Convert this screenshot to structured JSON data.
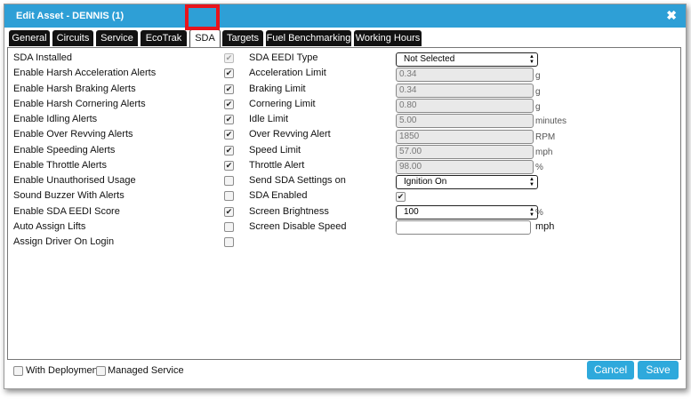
{
  "dialog": {
    "title": "Edit Asset - DENNIS (1)",
    "close_icon": "close-icon",
    "accent": "#2e9fd6"
  },
  "tabs": [
    "General",
    "Circuits",
    "Service",
    "EcoTrak",
    "SDA",
    "Targets",
    "Fuel Benchmarking",
    "Working Hours"
  ],
  "active_tab": "SDA",
  "left_settings": [
    {
      "label": "SDA Installed",
      "checked": true,
      "disabled": true
    },
    {
      "label": "Enable Harsh Acceleration Alerts",
      "checked": true
    },
    {
      "label": "Enable Harsh Braking Alerts",
      "checked": true
    },
    {
      "label": "Enable Harsh Cornering Alerts",
      "checked": true
    },
    {
      "label": "Enable Idling Alerts",
      "checked": true
    },
    {
      "label": "Enable Over Revving Alerts",
      "checked": true
    },
    {
      "label": "Enable Speeding Alerts",
      "checked": true
    },
    {
      "label": "Enable Throttle Alerts",
      "checked": true
    },
    {
      "label": "Enable Unauthorised Usage",
      "checked": false
    },
    {
      "label": "Sound Buzzer With Alerts",
      "checked": false
    },
    {
      "label": "Enable SDA EEDI Score",
      "checked": true
    },
    {
      "label": "Auto Assign Lifts",
      "checked": false
    },
    {
      "label": "Assign Driver On Login",
      "checked": false
    }
  ],
  "right_settings": {
    "eedi_type": {
      "label": "SDA EEDI Type",
      "value": "Not Selected"
    },
    "acceleration_limit": {
      "label": "Acceleration Limit",
      "value": "0.34",
      "unit": "g"
    },
    "braking_limit": {
      "label": "Braking Limit",
      "value": "0.34",
      "unit": "g"
    },
    "cornering_limit": {
      "label": "Cornering Limit",
      "value": "0.80",
      "unit": "g"
    },
    "idle_limit": {
      "label": "Idle Limit",
      "value": "5.00",
      "unit": "minutes"
    },
    "over_revving_alert": {
      "label": "Over Revving Alert",
      "value": "1850",
      "unit": "RPM"
    },
    "speed_limit": {
      "label": "Speed Limit",
      "value": "57.00",
      "unit": "mph"
    },
    "throttle_alert": {
      "label": "Throttle Alert",
      "value": "98.00",
      "unit": "%"
    },
    "send_settings_on": {
      "label": "Send SDA Settings on",
      "value": "Ignition On"
    },
    "sda_enabled": {
      "label": "SDA Enabled",
      "checked": true
    },
    "screen_brightness": {
      "label": "Screen Brightness",
      "value": "100",
      "unit": "%"
    },
    "screen_disable_speed": {
      "label": "Screen Disable Speed",
      "value": "",
      "unit": "mph"
    }
  },
  "footer": {
    "with_deployment": {
      "label": "With Deployment",
      "checked": false
    },
    "managed_service": {
      "label": "Managed Service",
      "checked": false
    },
    "cancel_label": "Cancel",
    "save_label": "Save"
  }
}
